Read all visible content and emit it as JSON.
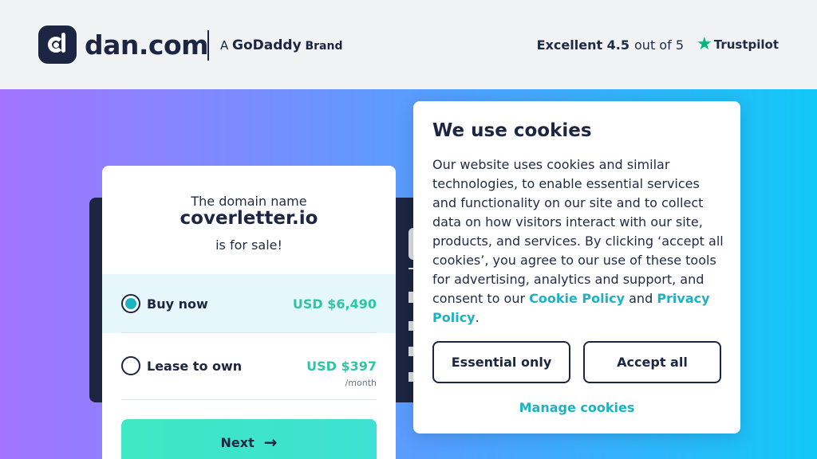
{
  "header": {
    "logo_text": "dan.com",
    "godaddy_a": "A",
    "godaddy_name": "GoDaddy",
    "godaddy_brand": "Brand",
    "rating_label": "Excellent 4.5",
    "rating_outof": "out of 5",
    "trustpilot_label": "Trustpilot",
    "trustpilot_color": "#00b67a"
  },
  "sale_card": {
    "domain_label": "The domain name",
    "domain_name": "coverletter.io",
    "for_sale": "is for sale!",
    "options": [
      {
        "label": "Buy now",
        "price": "USD $6,490",
        "per": "",
        "selected": true
      },
      {
        "label": "Lease to own",
        "price": "USD $397",
        "per": "/month",
        "selected": false
      }
    ],
    "next_label": "Next"
  },
  "cookie": {
    "title": "We use cookies",
    "body_text": "Our website uses cookies and similar technologies, to enable essential services and functionality on our site and to collect data on how visitors interact with our site, products, and services. By clicking ‘accept all cookies’, you agree to our use of these tools for advertising, analytics and support, and consent to our ",
    "cookie_policy": "Cookie Policy",
    "and": " and ",
    "privacy_policy": "Privacy Policy",
    "end": ".",
    "essential_label": "Essential only",
    "accept_label": "Accept all",
    "manage_label": "Manage cookies"
  },
  "colors": {
    "accent": "#1bb3c1",
    "price_green": "#2ec5a5",
    "navy": "#1c2541"
  }
}
